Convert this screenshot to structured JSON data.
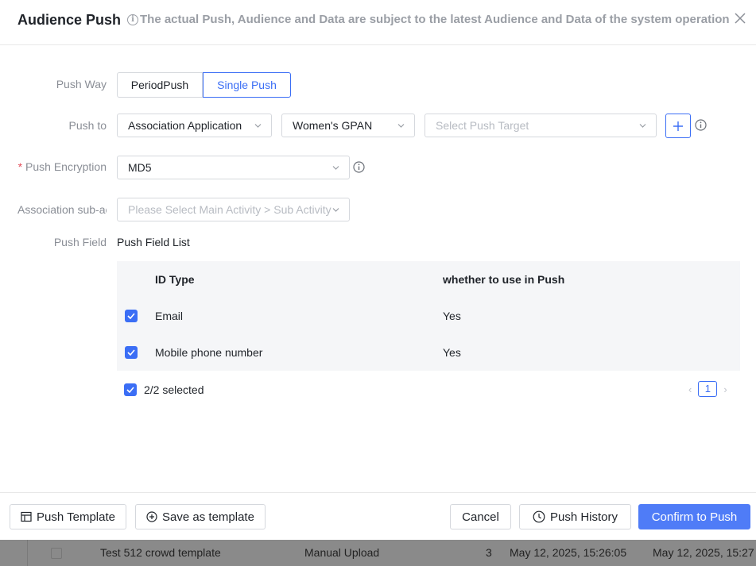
{
  "header": {
    "title": "Audience Push",
    "notice": "The actual Push, Audience and Data are subject to the latest Audience and Data of the system operation"
  },
  "form": {
    "push_way": {
      "label": "Push Way",
      "options": [
        "PeriodPush",
        "Single Push"
      ],
      "selected": "Single Push"
    },
    "push_to": {
      "label": "Push to",
      "app_value": "Association Application",
      "channel_value": "Women's GPAN",
      "target_placeholder": "Select Push Target"
    },
    "push_encryption": {
      "label": "Push Encryption",
      "value": "MD5"
    },
    "association_sub_activity": {
      "label": "Association sub-activity",
      "placeholder": "Please Select Main Activity > Sub Activity"
    },
    "push_field": {
      "label": "Push Field",
      "list_title": "Push Field List",
      "columns": [
        "ID Type",
        "whether to use in Push"
      ],
      "rows": [
        {
          "id_type": "Email",
          "use_in_push": "Yes",
          "checked": true
        },
        {
          "id_type": "Mobile phone number",
          "use_in_push": "Yes",
          "checked": true
        }
      ],
      "selected_summary": "2/2 selected",
      "current_page": "1"
    }
  },
  "footer": {
    "push_template": "Push Template",
    "save_as_template": "Save as template",
    "cancel": "Cancel",
    "push_history": "Push History",
    "confirm": "Confirm to Push"
  },
  "background_row": {
    "name": "Test 512 crowd template",
    "source": "Manual Upload",
    "count": "3",
    "created": "May 12, 2025, 15:26:05",
    "updated": "May 12, 2025, 15:27"
  },
  "colors": {
    "accent": "#3b6ef5",
    "primary_button": "#4f7cf7",
    "required": "#e34d59"
  }
}
